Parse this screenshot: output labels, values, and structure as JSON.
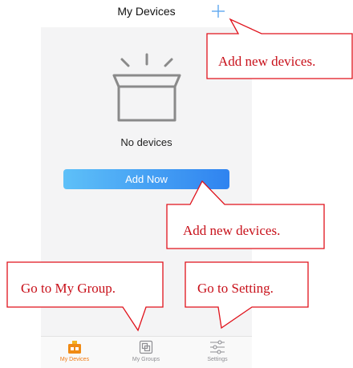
{
  "header": {
    "title": "My Devices",
    "add_icon": "plus-icon"
  },
  "empty_state": {
    "illustration_icon": "empty-box-icon",
    "message": "No devices"
  },
  "add_button": {
    "label": "Add Now"
  },
  "tabbar": {
    "active_color": "#f07a12",
    "inactive_color": "#8e8e93",
    "items": [
      {
        "label": "My Devices",
        "icon": "device-icon",
        "active": true
      },
      {
        "label": "My Groups",
        "icon": "groups-icon",
        "active": false
      },
      {
        "label": "Settings",
        "icon": "sliders-icon",
        "active": false
      }
    ]
  },
  "annotations": {
    "color": "#e0121b",
    "top_right": "Add new devices.",
    "middle": "Add new devices.",
    "bottom_left": "Go to My Group.",
    "bottom_right": "Go to Setting."
  }
}
